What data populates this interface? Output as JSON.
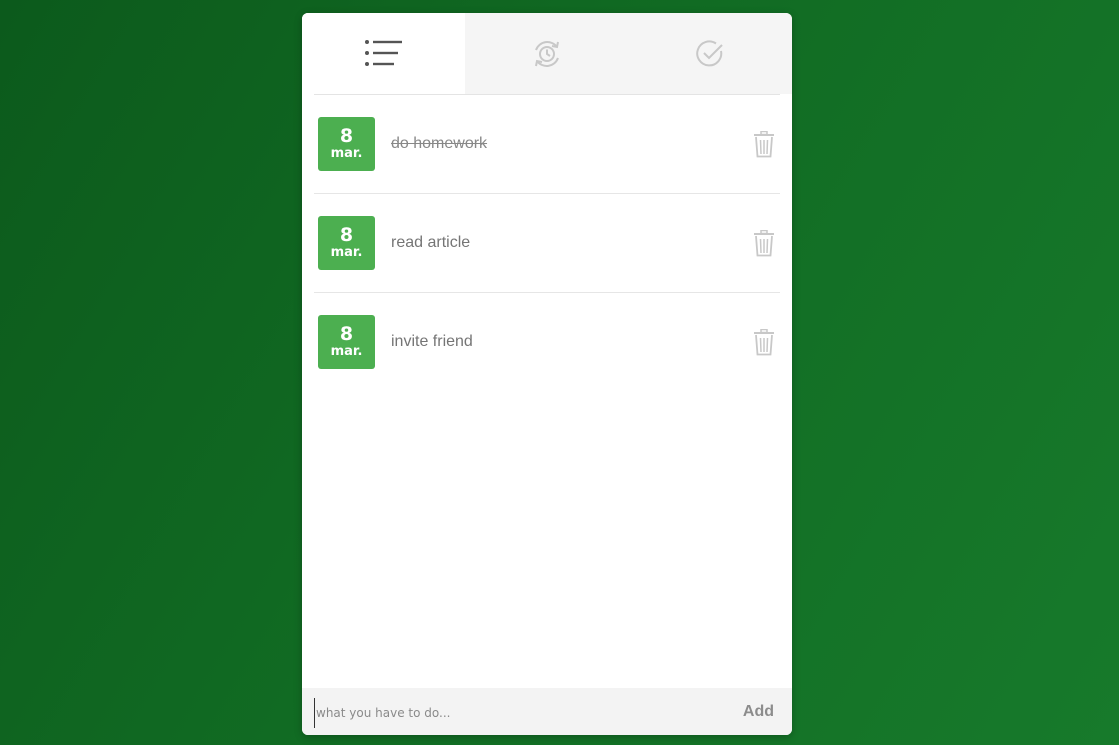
{
  "tabs": [
    {
      "icon": "list-icon",
      "active": true
    },
    {
      "icon": "history-sync-icon",
      "active": false
    },
    {
      "icon": "checkmark-circle-icon",
      "active": false
    }
  ],
  "tasks": [
    {
      "day": "8",
      "month": "mar.",
      "text": "do homework",
      "completed": true
    },
    {
      "day": "8",
      "month": "mar.",
      "text": "read article",
      "completed": false
    },
    {
      "day": "8",
      "month": "mar.",
      "text": "invite friend",
      "completed": false
    }
  ],
  "input": {
    "value": "",
    "placeholder": "what you have to do..."
  },
  "add_label": "Add",
  "colors": {
    "background": "#0f6220",
    "badge": "#4caf50",
    "text": "#757575",
    "icon": "#c8c8c8"
  }
}
